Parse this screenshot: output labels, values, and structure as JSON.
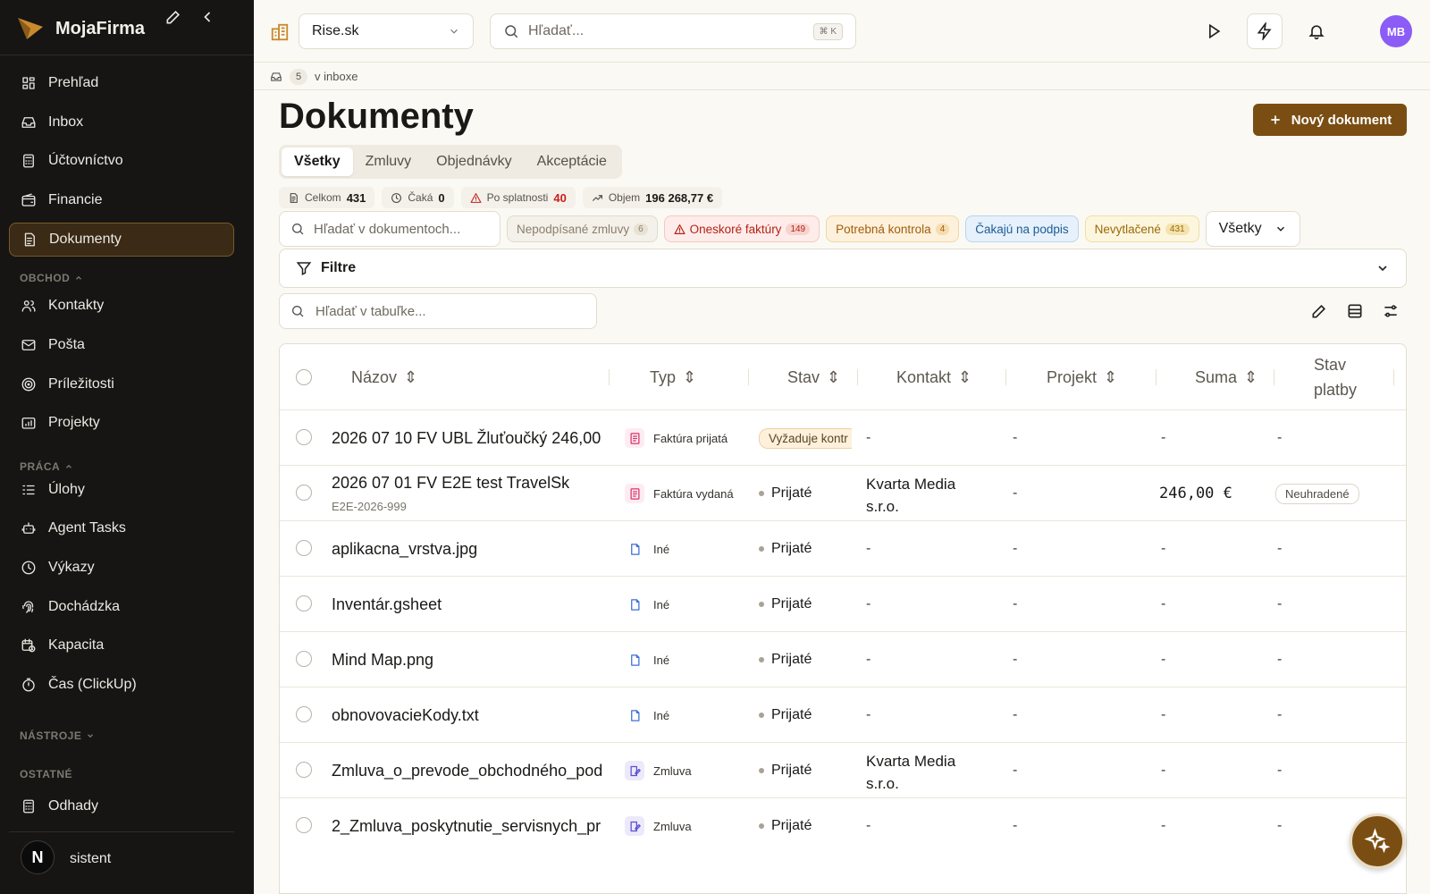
{
  "app": {
    "name": "MojaFirma"
  },
  "sidebar": {
    "main": [
      {
        "label": "Prehľad",
        "icon": "dashboard-icon"
      },
      {
        "label": "Inbox",
        "icon": "inbox-icon"
      },
      {
        "label": "Účtovníctvo",
        "icon": "calculator-icon"
      },
      {
        "label": "Financie",
        "icon": "wallet-icon"
      },
      {
        "label": "Dokumenty",
        "icon": "document-icon",
        "active": true
      }
    ],
    "sections": {
      "obchod": "OBCHOD",
      "praca": "PRÁCA",
      "nastroje": "NÁSTROJE",
      "ostatne": "OSTATNÉ"
    },
    "obchod": [
      {
        "label": "Kontakty",
        "icon": "users-icon"
      },
      {
        "label": "Pošta",
        "icon": "mail-icon"
      },
      {
        "label": "Príležitosti",
        "icon": "target-icon"
      },
      {
        "label": "Projekty",
        "icon": "projects-icon"
      }
    ],
    "praca": [
      {
        "label": "Úlohy",
        "icon": "tasks-icon"
      },
      {
        "label": "Agent Tasks",
        "icon": "bot-icon"
      },
      {
        "label": "Výkazy",
        "icon": "clock-icon"
      },
      {
        "label": "Dochádzka",
        "icon": "fingerprint-icon"
      },
      {
        "label": "Kapacita",
        "icon": "calendar-clock-icon"
      },
      {
        "label": "Čas (ClickUp)",
        "icon": "timer-icon"
      }
    ],
    "ostatne": [
      {
        "label": "Odhady",
        "icon": "calculator-icon"
      }
    ],
    "assistant": "sistent",
    "n_badge": "N"
  },
  "topbar": {
    "workspace": "Rise.sk",
    "search_placeholder": "Hľadať...",
    "shortcut": "⌘ K",
    "avatar": "MB"
  },
  "inbox": {
    "count": "5",
    "label": "v inboxe"
  },
  "page": {
    "title": "Dokumenty",
    "new_button": "Nový dokument",
    "tabs": [
      "Všetky",
      "Zmluvy",
      "Objednávky",
      "Akceptácie"
    ],
    "stats": [
      {
        "label": "Celkom",
        "value": "431",
        "icon": "document-icon"
      },
      {
        "label": "Čaká",
        "value": "0",
        "icon": "clock-icon"
      },
      {
        "label": "Po splatnosti",
        "value": "40",
        "icon": "warning-icon"
      },
      {
        "label": "Objem",
        "value": "196 268,77 €",
        "icon": "trend-icon"
      }
    ],
    "doc_search_placeholder": "Hľadať v dokumentoch...",
    "chips": [
      {
        "label": "Nepodpísané zmluvy",
        "count": "6",
        "color": "#8a7f6c"
      },
      {
        "label": "Oneskoré faktúry",
        "count": "149",
        "color": "#b42318"
      },
      {
        "label": "Potrebná kontrola",
        "count": "4",
        "color": "#a35c0a"
      },
      {
        "label": "Čakajú na podpis",
        "count": "",
        "color": "#1d5b96"
      },
      {
        "label": "Nevytlačené",
        "count": "431",
        "color": "#9a6b07"
      }
    ],
    "all_select": "Všetky",
    "filters_label": "Filtre",
    "table_search_placeholder": "Hľadať v tabuľke..."
  },
  "table": {
    "headers": {
      "name": "Názov",
      "type": "Typ",
      "status": "Stav",
      "contact": "Kontakt",
      "project": "Projekt",
      "sum": "Suma",
      "payment_1": "Stav",
      "payment_2": "platby"
    },
    "rows": [
      {
        "name": "2026 07 10 FV UBL Žluťoučký 246,00",
        "sub": "",
        "type": "Faktúra prijatá",
        "type_icon": "invoice-icon",
        "status": "Vyžaduje kontr",
        "status_pill": true,
        "contact": "-",
        "project": "-",
        "sum": "-",
        "payment": "-"
      },
      {
        "name": "2026 07 01 FV E2E test TravelSk",
        "sub": "E2E-2026-999",
        "type": "Faktúra vydaná",
        "type_icon": "invoice-icon",
        "status": "Prijaté",
        "contact": "Kvarta Media s.r.o.",
        "project": "-",
        "sum": "246,00 €",
        "payment": "Neuhradené",
        "payment_pill": true
      },
      {
        "name": "aplikacna_vrstva.jpg",
        "sub": "",
        "type": "Iné",
        "type_icon": "file-icon",
        "status": "Prijaté",
        "contact": "-",
        "project": "-",
        "sum": "-",
        "payment": "-"
      },
      {
        "name": "Inventár.gsheet",
        "sub": "",
        "type": "Iné",
        "type_icon": "file-icon",
        "status": "Prijaté",
        "contact": "-",
        "project": "-",
        "sum": "-",
        "payment": "-"
      },
      {
        "name": "Mind Map.png",
        "sub": "",
        "type": "Iné",
        "type_icon": "file-icon",
        "status": "Prijaté",
        "contact": "-",
        "project": "-",
        "sum": "-",
        "payment": "-"
      },
      {
        "name": "obnovovacieKody.txt",
        "sub": "",
        "type": "Iné",
        "type_icon": "file-icon",
        "status": "Prijaté",
        "contact": "-",
        "project": "-",
        "sum": "-",
        "payment": "-"
      },
      {
        "name": "Zmluva_o_prevode_obchodného_pod",
        "sub": "",
        "type": "Zmluva",
        "type_icon": "contract-icon",
        "status": "Prijaté",
        "contact": "Kvarta Media s.r.o.",
        "project": "-",
        "sum": "-",
        "payment": "-"
      },
      {
        "name": "2_Zmluva_poskytnutie_servisnych_pr",
        "sub": "",
        "type": "Zmluva",
        "type_icon": "contract-icon",
        "status": "Prijaté",
        "contact": "-",
        "project": "-",
        "sum": "-",
        "payment": "-"
      }
    ]
  },
  "colors": {
    "accent": "#7a4e12",
    "sidebar": "#161514",
    "avatar": "#8b5cf6",
    "danger": "#c81e1e"
  }
}
